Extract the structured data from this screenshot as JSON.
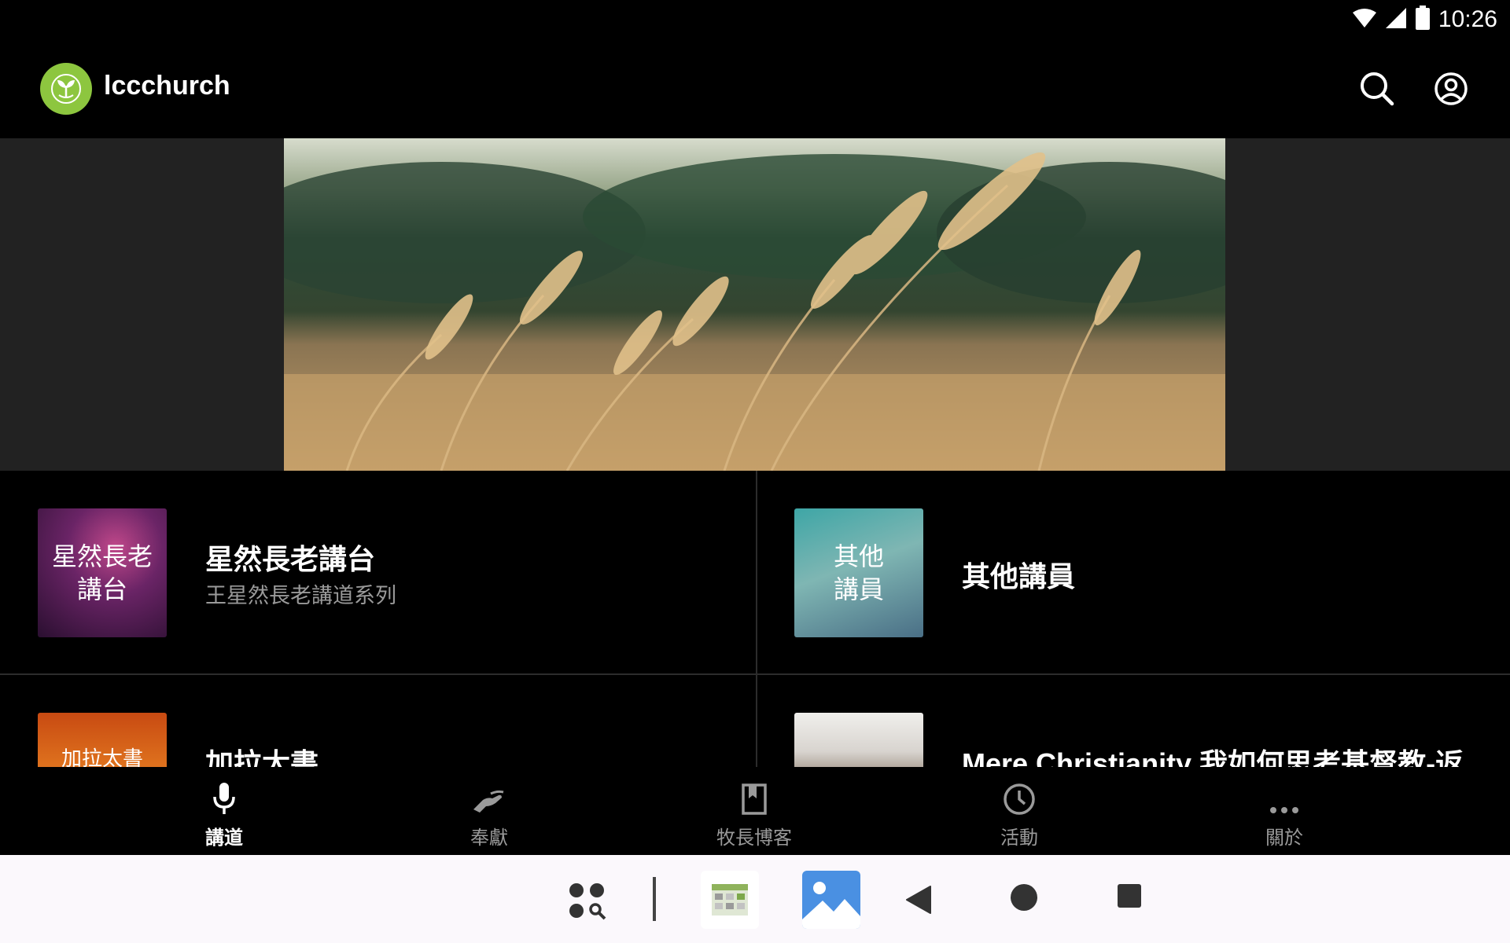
{
  "status_bar": {
    "time": "10:26",
    "icons": [
      "wifi-icon",
      "cell-signal-icon",
      "battery-icon"
    ]
  },
  "app_bar": {
    "title": "lccchurch",
    "actions": [
      "search-icon",
      "account-icon"
    ]
  },
  "colors": {
    "logo_green": "#8dc63f",
    "background": "#000000",
    "hero_band": "#222222",
    "subtitle_gray": "#9a9a9a",
    "system_nav_bg": "#fbf8fc"
  },
  "series": [
    {
      "thumb_text": "星然長老\n講台",
      "title": "星然長老講台",
      "subtitle": "王星然長老講道系列"
    },
    {
      "thumb_text": "其他\n講員",
      "title": "其他講員",
      "subtitle": ""
    },
    {
      "thumb_text": "加拉太書",
      "title": "加拉太書",
      "subtitle": ""
    },
    {
      "thumb_text": "",
      "title": "Mere Christianity 我如何思考基督教-返",
      "subtitle": ""
    }
  ],
  "bottom_nav": [
    {
      "label": "講道",
      "icon": "microphone-icon",
      "active": true
    },
    {
      "label": "奉獻",
      "icon": "offering-hand-icon",
      "active": false
    },
    {
      "label": "牧長博客",
      "icon": "bookmark-icon",
      "active": false
    },
    {
      "label": "活動",
      "icon": "clock-icon",
      "active": false
    },
    {
      "label": "關於",
      "icon": "more-dots-icon",
      "active": false
    }
  ],
  "system_nav": [
    "app-search-icon",
    "calendar-app-icon",
    "gallery-app-icon",
    "back-icon",
    "home-icon",
    "recents-icon"
  ]
}
